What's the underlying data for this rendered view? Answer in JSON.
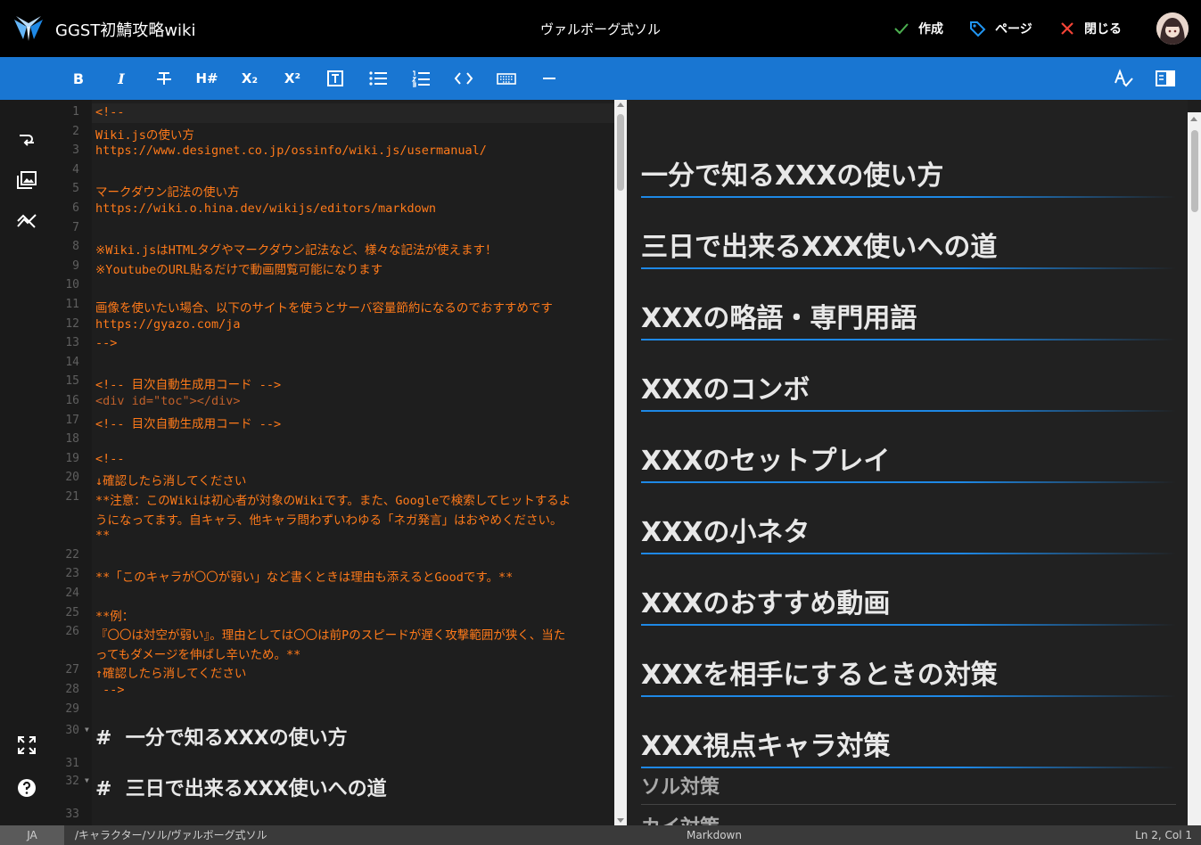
{
  "header": {
    "site_title": "GGST初鯖攻略wiki",
    "page_title": "ヴァルボーグ式ソル",
    "create_label": "作成",
    "page_label": "ページ",
    "close_label": "閉じる"
  },
  "toolbar": {
    "bold": "B",
    "italic": "I",
    "strike": "S",
    "heading": "H#",
    "subscript": "X₂",
    "superscript": "X²"
  },
  "editor": {
    "lines": [
      {
        "n": "1",
        "text": "<!--"
      },
      {
        "n": "2",
        "text": "Wiki.jsの使い方"
      },
      {
        "n": "3",
        "text": "https://www.designet.co.jp/ossinfo/wiki.js/usermanual/"
      },
      {
        "n": "4",
        "text": ""
      },
      {
        "n": "5",
        "text": "マークダウン記法の使い方"
      },
      {
        "n": "6",
        "text": "https://wiki.o.hina.dev/wikijs/editors/markdown"
      },
      {
        "n": "7",
        "text": ""
      },
      {
        "n": "8",
        "text": "※Wiki.jsはHTMLタグやマークダウン記法など、様々な記法が使えます！"
      },
      {
        "n": "9",
        "text": "※YoutubeのURL貼るだけで動画閲覧可能になります"
      },
      {
        "n": "10",
        "text": ""
      },
      {
        "n": "11",
        "text": "画像を使いたい場合、以下のサイトを使うとサーバ容量節約になるのでおすすめです"
      },
      {
        "n": "12",
        "text": "https://gyazo.com/ja"
      },
      {
        "n": "13",
        "text": "-->"
      },
      {
        "n": "14",
        "text": ""
      },
      {
        "n": "15",
        "text": "<!-- 目次自動生成用コード -->"
      },
      {
        "n": "16",
        "text": "<div id=\"toc\"></div>"
      },
      {
        "n": "17",
        "text": "<!-- 目次自動生成用コード -->"
      },
      {
        "n": "18",
        "text": ""
      },
      {
        "n": "19",
        "text": "<!--"
      },
      {
        "n": "20",
        "text": "↓確認したら消してください"
      },
      {
        "n": "21",
        "text": "**注意：このWikiは初心者が対象のWikiです。また、Googleで検索してヒットするよ"
      },
      {
        "n": "",
        "text": "うになってます。自キャラ、他キャラ問わずいわゆる「ネガ発言」はおやめください。"
      },
      {
        "n": "",
        "text": "**"
      },
      {
        "n": "22",
        "text": ""
      },
      {
        "n": "23",
        "text": "**「このキャラが〇〇が弱い」など書くときは理由も添えるとGoodです。**"
      },
      {
        "n": "24",
        "text": ""
      },
      {
        "n": "25",
        "text": "**例："
      },
      {
        "n": "26",
        "text": "『〇〇は対空が弱い』。理由としては〇〇は前Pのスピードが遅く攻撃範囲が狭く、当た"
      },
      {
        "n": "",
        "text": "ってもダメージを伸ばし辛いため。**"
      },
      {
        "n": "27",
        "text": "↑確認したら消してください"
      },
      {
        "n": "28",
        "text": " -->"
      },
      {
        "n": "29",
        "text": ""
      }
    ],
    "heading_lines": [
      {
        "n": "30",
        "text": "#  一分で知るXXXの使い方"
      },
      {
        "n": "31",
        "text": ""
      },
      {
        "n": "32",
        "text": "#  三日で出来るXXX使いへの道"
      },
      {
        "n": "33",
        "text": ""
      }
    ]
  },
  "preview": {
    "h1": [
      "一分で知るXXXの使い方",
      "三日で出来るXXX使いへの道",
      "XXXの略語・専門用語",
      "XXXのコンボ",
      "XXXのセットプレイ",
      "XXXの小ネタ",
      "XXXのおすすめ動画",
      "XXXを相手にするときの対策",
      "XXX視点キャラ対策"
    ],
    "h2": [
      "ソル対策",
      "カイ対策"
    ]
  },
  "status": {
    "lang": "JA",
    "path": "/キャラクター/ソル/ヴァルボーグ式ソル",
    "mode": "Markdown",
    "position": "Ln 2, Col 1"
  },
  "colors": {
    "accent": "#1976d2",
    "code_text": "#ff7a1a",
    "check": "#4caf50",
    "close": "#f44336"
  }
}
